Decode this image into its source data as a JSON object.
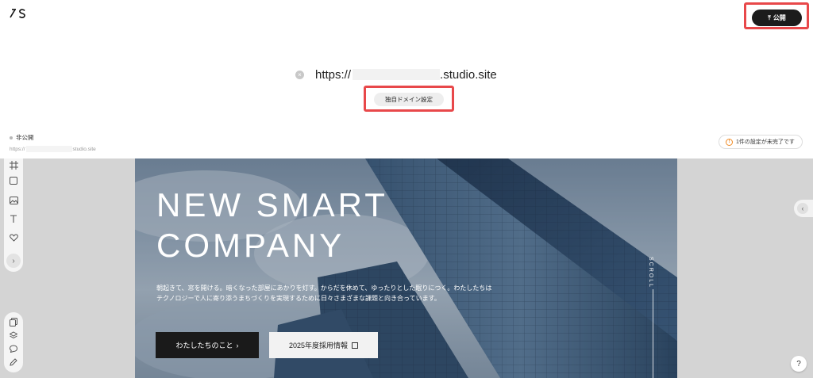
{
  "header": {
    "logo_text": "/S",
    "publish_label": "公開",
    "publish_icon": "publish-arrow-icon"
  },
  "url": {
    "prefix": "https://",
    "suffix": ".studio.site"
  },
  "domain_button_label": "独自ドメイン設定",
  "site_status": {
    "label": "非公開",
    "url_prefix": "https://",
    "url_suffix": "studio.site"
  },
  "incomplete_badge": "1件の設定が未完了です",
  "hero": {
    "title": "NEW SMART\nCOMPANY",
    "body": "朝起きて、窓を開ける。暗くなった部屋にあかりを灯す。からだを休めて、ゆったりとした眠りにつく。わたしたちはテクノロジーで人に寄り添うまちづくりを実現するために日々さまざまな課題と向き合っています。",
    "primary_cta": "わたしたちのこと",
    "primary_cta_icon": "›",
    "secondary_cta": "2025年度採用情報",
    "scroll_label": "SCROLL"
  },
  "help_label": "?",
  "colors": {
    "accent_highlight": "#e8484a",
    "publish_bg": "#1c1c1c",
    "warning": "#f08a24"
  }
}
